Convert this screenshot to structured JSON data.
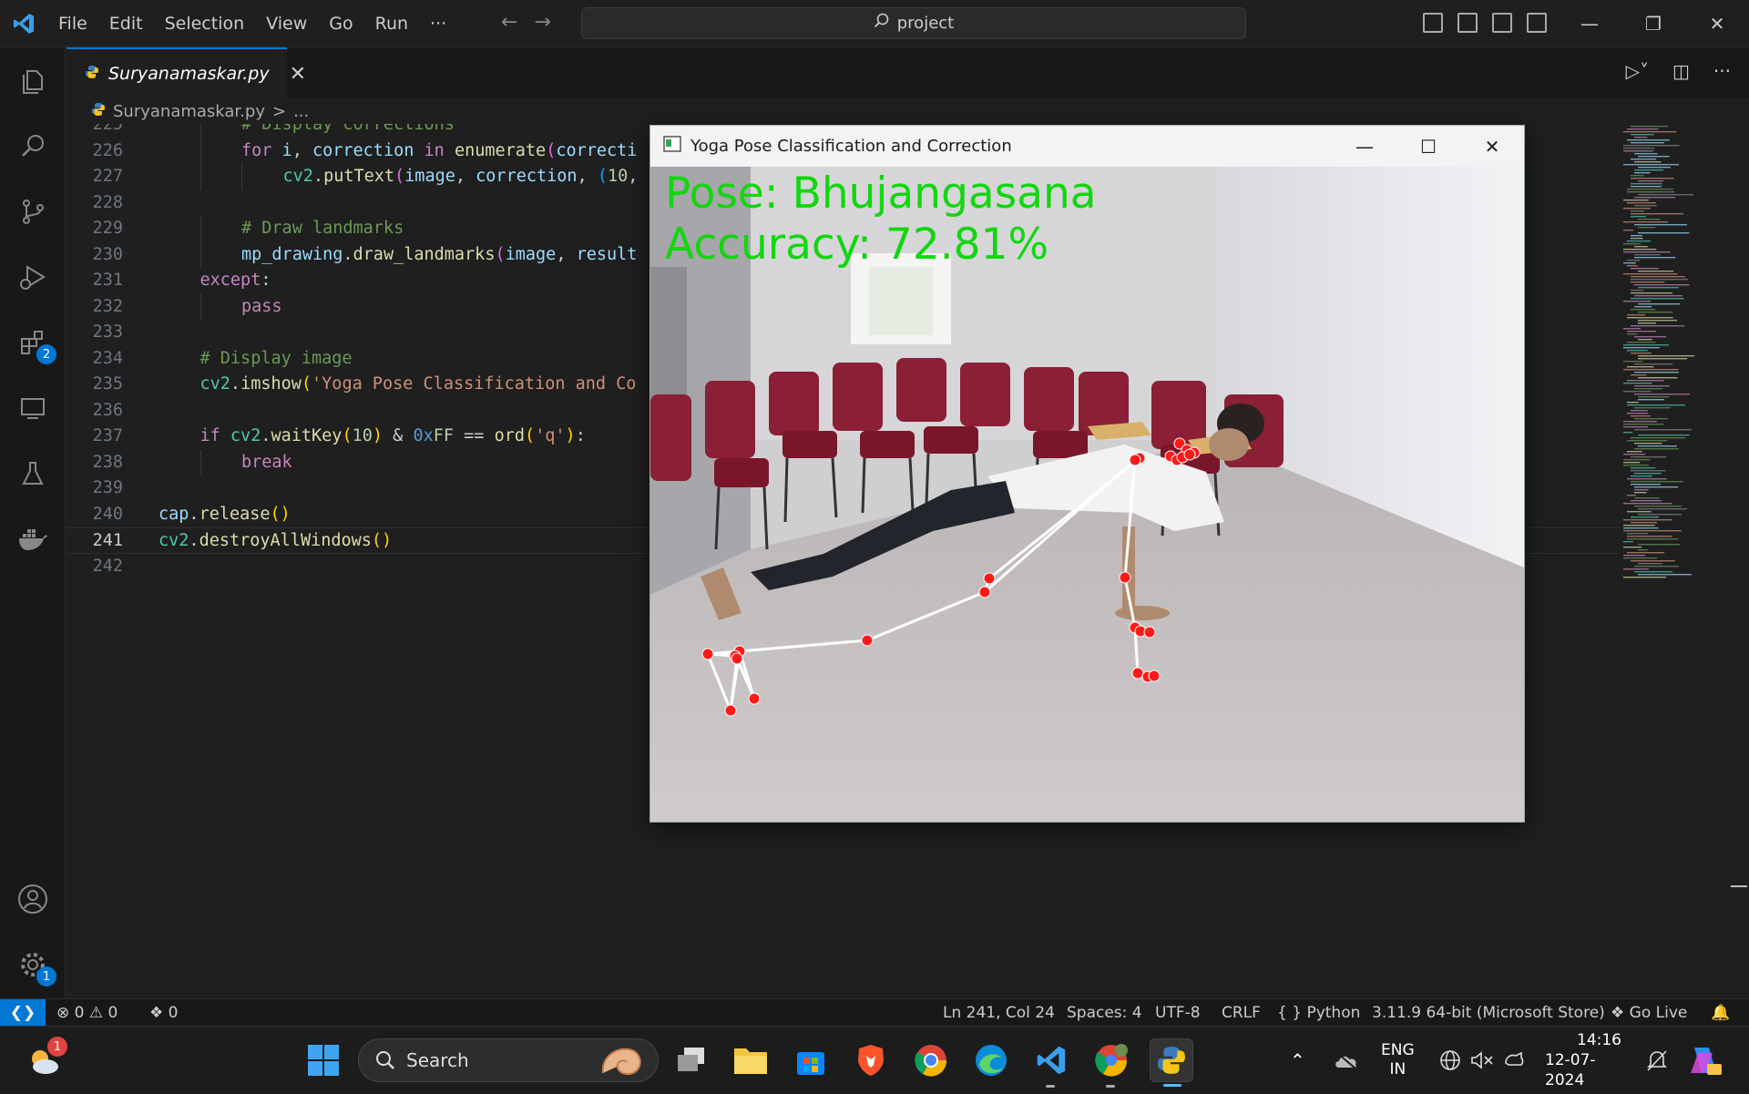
{
  "menu": [
    "File",
    "Edit",
    "Selection",
    "View",
    "Go",
    "Run",
    "···"
  ],
  "search": {
    "text": "project"
  },
  "activity_badges": {
    "extensions": "2",
    "manage": "1"
  },
  "tab": {
    "name": "Suryanamaskar.py",
    "close": "✕"
  },
  "breadcrumb": {
    "file": "Suryanamaskar.py",
    "sep": ">",
    "more": "..."
  },
  "code_lines": [
    {
      "n": "225",
      "indent": 2,
      "parts": [
        {
          "t": "# Display corrections",
          "c": "#6a9955"
        }
      ]
    },
    {
      "n": "226",
      "indent": 2,
      "parts": [
        {
          "t": "for ",
          "c": "#c586c0"
        },
        {
          "t": "i",
          "c": "#9cdcfe"
        },
        {
          "t": ", ",
          "c": "#cccccc"
        },
        {
          "t": "correction",
          "c": "#9cdcfe"
        },
        {
          "t": " in ",
          "c": "#c586c0"
        },
        {
          "t": "enumerate",
          "c": "#dcdcaa"
        },
        {
          "t": "(",
          "c": "#da70d6"
        },
        {
          "t": "correcti",
          "c": "#9cdcfe"
        }
      ]
    },
    {
      "n": "227",
      "indent": 3,
      "parts": [
        {
          "t": "cv2",
          "c": "#4ec9b0"
        },
        {
          "t": ".",
          "c": "#cccccc"
        },
        {
          "t": "putText",
          "c": "#dcdcaa"
        },
        {
          "t": "(",
          "c": "#da70d6"
        },
        {
          "t": "image",
          "c": "#9cdcfe"
        },
        {
          "t": ", ",
          "c": "#cccccc"
        },
        {
          "t": "correction",
          "c": "#9cdcfe"
        },
        {
          "t": ", ",
          "c": "#cccccc"
        },
        {
          "t": "(",
          "c": "#179fff"
        },
        {
          "t": "10",
          "c": "#b5cea8"
        },
        {
          "t": ",",
          "c": "#cccccc"
        }
      ]
    },
    {
      "n": "228",
      "indent": 0,
      "parts": []
    },
    {
      "n": "229",
      "indent": 2,
      "parts": [
        {
          "t": "# Draw landmarks",
          "c": "#6a9955"
        }
      ]
    },
    {
      "n": "230",
      "indent": 2,
      "parts": [
        {
          "t": "mp_drawing",
          "c": "#9cdcfe"
        },
        {
          "t": ".",
          "c": "#cccccc"
        },
        {
          "t": "draw_landmarks",
          "c": "#dcdcaa"
        },
        {
          "t": "(",
          "c": "#da70d6"
        },
        {
          "t": "image",
          "c": "#9cdcfe"
        },
        {
          "t": ", ",
          "c": "#cccccc"
        },
        {
          "t": "result",
          "c": "#9cdcfe"
        }
      ]
    },
    {
      "n": "231",
      "indent": 1,
      "parts": [
        {
          "t": "except",
          "c": "#c586c0"
        },
        {
          "t": ":",
          "c": "#cccccc"
        }
      ]
    },
    {
      "n": "232",
      "indent": 2,
      "parts": [
        {
          "t": "pass",
          "c": "#c586c0"
        }
      ]
    },
    {
      "n": "233",
      "indent": 0,
      "parts": []
    },
    {
      "n": "234",
      "indent": 1,
      "parts": [
        {
          "t": "# Display image",
          "c": "#6a9955"
        }
      ]
    },
    {
      "n": "235",
      "indent": 1,
      "parts": [
        {
          "t": "cv2",
          "c": "#4ec9b0"
        },
        {
          "t": ".",
          "c": "#cccccc"
        },
        {
          "t": "imshow",
          "c": "#dcdcaa"
        },
        {
          "t": "(",
          "c": "#ffd700"
        },
        {
          "t": "'Yoga Pose Classification and Co",
          "c": "#ce9178"
        }
      ]
    },
    {
      "n": "236",
      "indent": 0,
      "parts": []
    },
    {
      "n": "237",
      "indent": 1,
      "parts": [
        {
          "t": "if ",
          "c": "#c586c0"
        },
        {
          "t": "cv2",
          "c": "#4ec9b0"
        },
        {
          "t": ".",
          "c": "#cccccc"
        },
        {
          "t": "waitKey",
          "c": "#dcdcaa"
        },
        {
          "t": "(",
          "c": "#ffd700"
        },
        {
          "t": "10",
          "c": "#b5cea8"
        },
        {
          "t": ")",
          "c": "#ffd700"
        },
        {
          "t": " & ",
          "c": "#cccccc"
        },
        {
          "t": "0x",
          "c": "#569cd6"
        },
        {
          "t": "FF",
          "c": "#b5cea8"
        },
        {
          "t": " == ",
          "c": "#cccccc"
        },
        {
          "t": "ord",
          "c": "#dcdcaa"
        },
        {
          "t": "(",
          "c": "#ffd700"
        },
        {
          "t": "'q'",
          "c": "#ce9178"
        },
        {
          "t": ")",
          "c": "#ffd700"
        },
        {
          "t": ":",
          "c": "#cccccc"
        }
      ]
    },
    {
      "n": "238",
      "indent": 2,
      "parts": [
        {
          "t": "break",
          "c": "#c586c0"
        }
      ]
    },
    {
      "n": "239",
      "indent": 0,
      "parts": []
    },
    {
      "n": "240",
      "indent": 0,
      "parts": [
        {
          "t": "cap",
          "c": "#9cdcfe"
        },
        {
          "t": ".",
          "c": "#cccccc"
        },
        {
          "t": "release",
          "c": "#dcdcaa"
        },
        {
          "t": "()",
          "c": "#ffd700"
        }
      ]
    },
    {
      "n": "241",
      "indent": 0,
      "parts": [
        {
          "t": "cv2",
          "c": "#4ec9b0"
        },
        {
          "t": ".",
          "c": "#cccccc"
        },
        {
          "t": "destroyAllWindows",
          "c": "#dcdcaa"
        },
        {
          "t": "()",
          "c": "#ffd700"
        }
      ]
    },
    {
      "n": "242",
      "indent": 0,
      "parts": []
    }
  ],
  "cv_window": {
    "title": "Yoga Pose Classification and Correction",
    "pose_text": "Pose: Bhujangasana",
    "accuracy_text": "Accuracy: 72.81%"
  },
  "statusbar": {
    "errors": "0",
    "warnings": "0",
    "ports": "0",
    "position": "Ln 241, Col 24",
    "spaces": "Spaces: 4",
    "encoding": "UTF-8",
    "eol": "CRLF",
    "language": "Python",
    "interpreter": "3.11.9 64-bit (Microsoft Store)",
    "golive": "Go Live"
  },
  "taskbar": {
    "weather_badge": "1",
    "search_placeholder": "Search",
    "lang_line1": "ENG",
    "lang_line2": "IN",
    "time": "14:16",
    "date": "12-07-2024"
  },
  "colors": {
    "accent": "#0078d4",
    "overlay_green": "#12d60e",
    "landmark_red": "#ff1a1a"
  }
}
